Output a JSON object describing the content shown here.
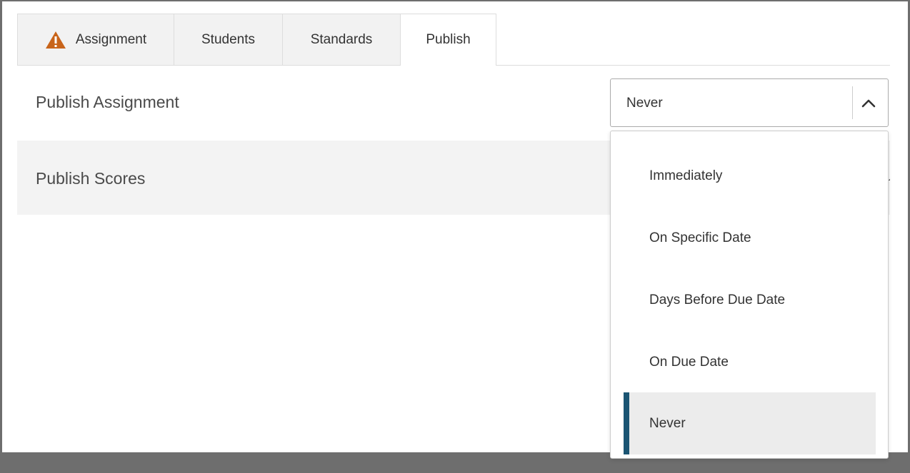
{
  "tabs": [
    {
      "label": "Assignment",
      "icon": "warning-icon",
      "active": false
    },
    {
      "label": "Students",
      "active": false
    },
    {
      "label": "Standards",
      "active": false
    },
    {
      "label": "Publish",
      "active": true
    }
  ],
  "publish_assignment": {
    "title": "Publish Assignment",
    "selected_value": "Never",
    "options": [
      {
        "label": "Immediately",
        "selected": false
      },
      {
        "label": "On Specific Date",
        "selected": false
      },
      {
        "label": "Days Before Due Date",
        "selected": false
      },
      {
        "label": "On Due Date",
        "selected": false
      },
      {
        "label": "Never",
        "selected": true
      }
    ]
  },
  "publish_scores": {
    "title": "Publish Scores"
  },
  "colors": {
    "warning": "#c8641a",
    "selected_accent": "#1b5573",
    "frame": "#6e6e6e"
  }
}
